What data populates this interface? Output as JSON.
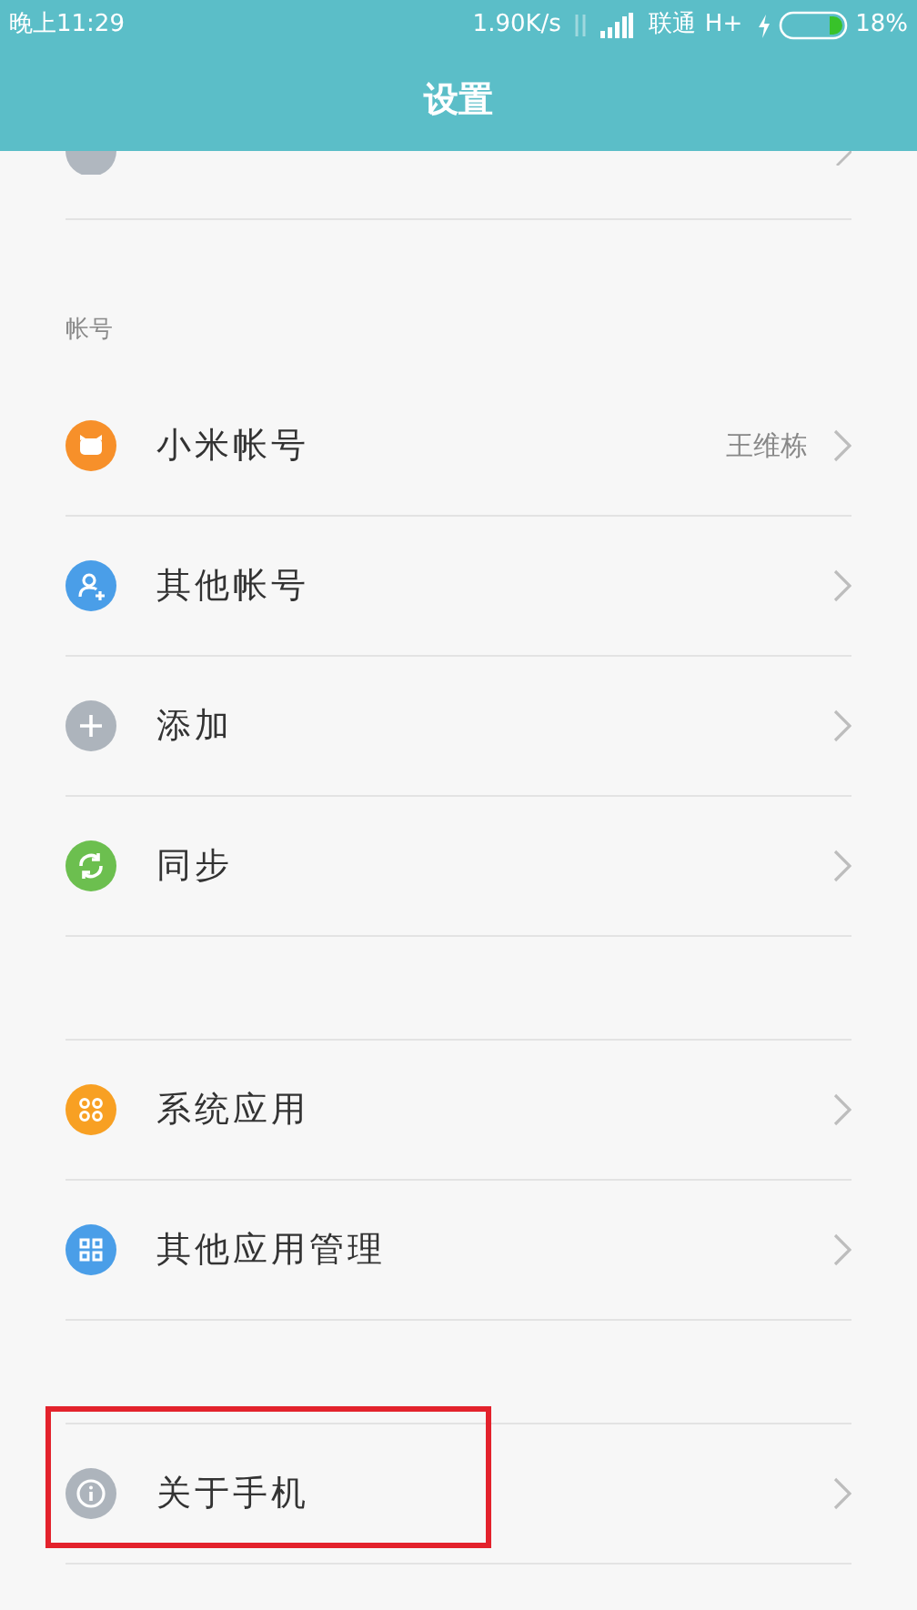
{
  "status_bar": {
    "time": "晚上11:29",
    "speed": "1.90K/s",
    "carrier": "联通",
    "network": "H+",
    "battery": "18%"
  },
  "header": {
    "title": "设置"
  },
  "groups": [
    {
      "clipped": true,
      "items": [
        {
          "kind": "more",
          "color": "#b0b7bf"
        }
      ]
    },
    {
      "header": "帐号",
      "items": [
        {
          "kind": "mi",
          "color": "#f7902a",
          "label": "小米帐号",
          "value": "王维栋",
          "highlighted": false
        },
        {
          "kind": "person-add",
          "color": "#4a9ee8",
          "label": "其他帐号",
          "highlighted": false
        },
        {
          "kind": "plus",
          "color": "#adb4bc",
          "label": "添加",
          "highlighted": false
        },
        {
          "kind": "sync",
          "color": "#6cbf4f",
          "label": "同步",
          "highlighted": false
        }
      ]
    },
    {
      "items": [
        {
          "kind": "apps",
          "color": "#f8a023",
          "label": "系统应用",
          "highlighted": false
        },
        {
          "kind": "grid",
          "color": "#4a9ee8",
          "label": "其他应用管理",
          "highlighted": false
        }
      ]
    },
    {
      "items": [
        {
          "kind": "info",
          "color": "#adb4bc",
          "label": "关于手机",
          "highlighted": true
        }
      ]
    }
  ]
}
